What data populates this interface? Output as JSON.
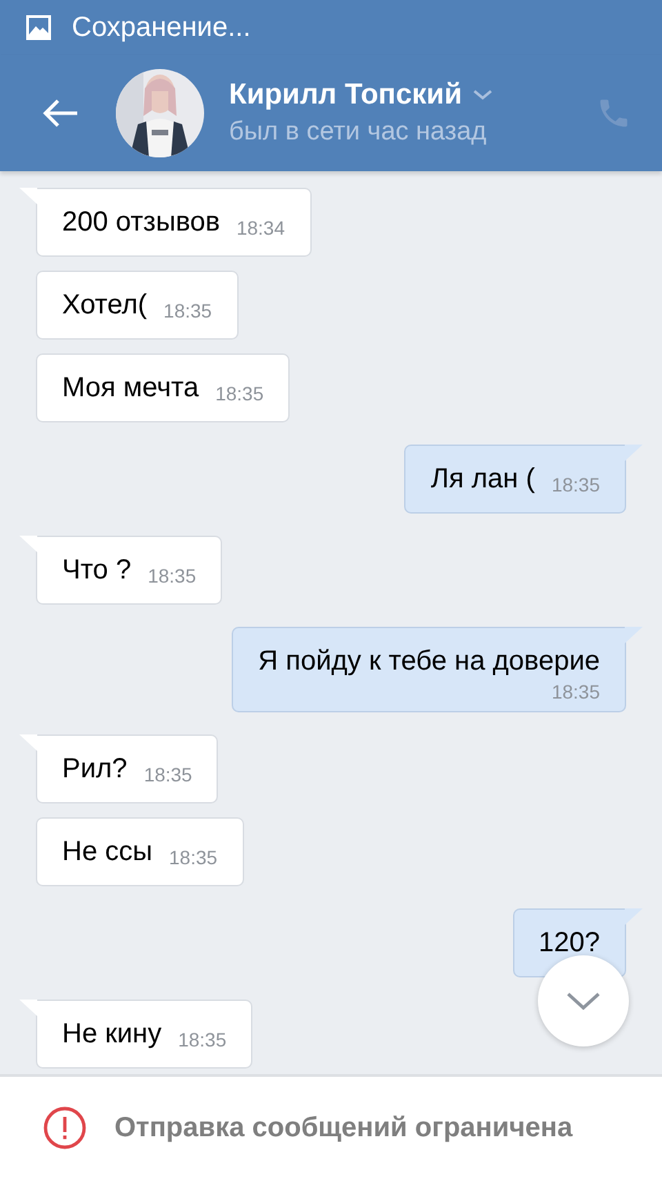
{
  "status_bar": {
    "notification": "Сохранение..."
  },
  "header": {
    "name": "Кирилл Топский",
    "subtitle": "был в сети час назад"
  },
  "messages": [
    {
      "kind": "incoming",
      "text": "200 отзывов",
      "time": "18:34"
    },
    {
      "kind": "incoming",
      "text": "Хотел(",
      "time": "18:35"
    },
    {
      "kind": "incoming",
      "text": "Моя мечта",
      "time": "18:35"
    },
    {
      "kind": "outgoing",
      "text": "Ля лан (",
      "time": "18:35"
    },
    {
      "kind": "incoming",
      "text": "Что ?",
      "time": "18:35"
    },
    {
      "kind": "outgoing",
      "text": "Я пойду к тебе на доверие",
      "time": "18:35",
      "time_below": true
    },
    {
      "kind": "incoming",
      "text": "Рил?",
      "time": "18:35"
    },
    {
      "kind": "incoming",
      "text": "Не ссы",
      "time": "18:35"
    },
    {
      "kind": "outgoing",
      "text": "120?"
    },
    {
      "kind": "incoming",
      "text": "Не кину",
      "time": "18:35"
    }
  ],
  "footer": {
    "notice": "Отправка сообщений ограничена"
  }
}
